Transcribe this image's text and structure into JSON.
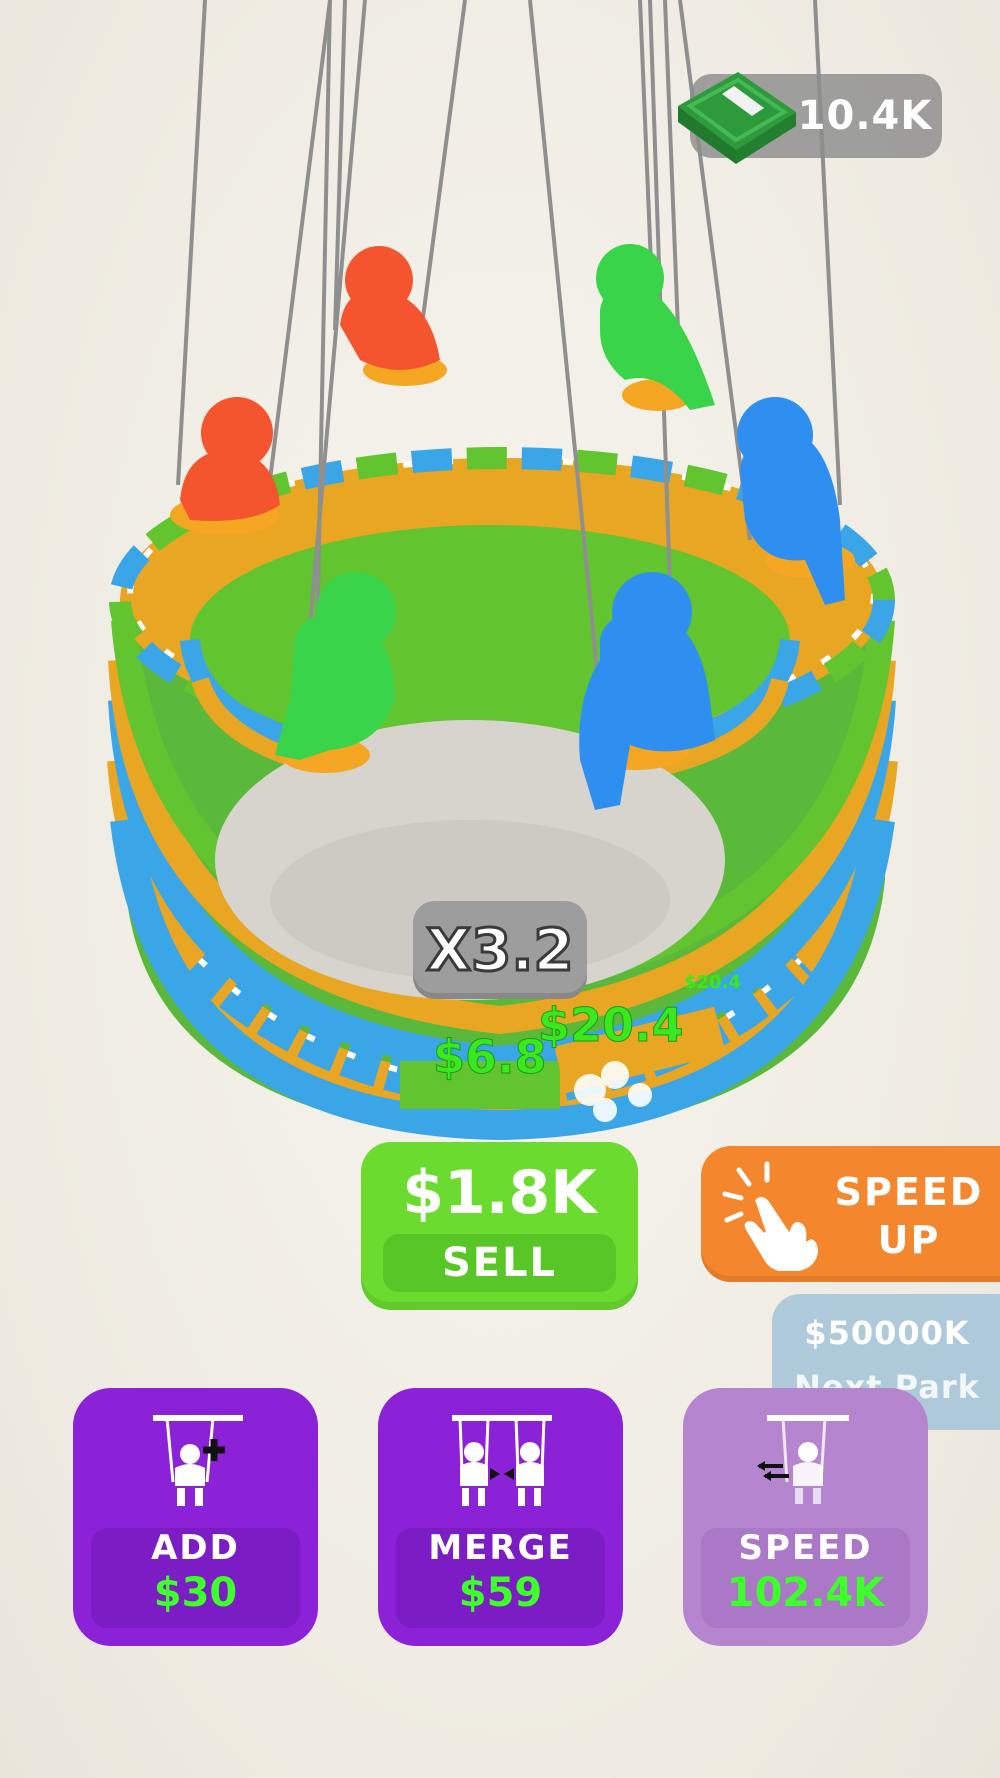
{
  "hud": {
    "money_value": "10.4K",
    "money_icon": "cash-bundle-icon"
  },
  "scene": {
    "multiplier": "X3.2",
    "floating_earnings": [
      "$6.8",
      "$20.4",
      "$20.4"
    ],
    "swing_riders": [
      {
        "color": "#f4552e"
      },
      {
        "color": "#f4552e"
      },
      {
        "color": "#3ad44a"
      },
      {
        "color": "#2f8ff0"
      },
      {
        "color": "#3ad44a"
      },
      {
        "color": "#2f8ff0"
      }
    ],
    "cash_colors": [
      "#3aa6e8",
      "#62c42f",
      "#e8a623"
    ]
  },
  "sell": {
    "amount": "$1.8K",
    "label": "SELL"
  },
  "speed_up": {
    "label_line1": "SPEED",
    "label_line2": "UP",
    "icon": "tap-hand-icon"
  },
  "next_park": {
    "amount": "$50000K",
    "label": "Next Park"
  },
  "upgrades": [
    {
      "label": "ADD",
      "price": "$30",
      "icon": "add-swing-icon"
    },
    {
      "label": "MERGE",
      "price": "$59",
      "icon": "merge-swings-icon"
    },
    {
      "label": "SPEED",
      "price": "102.4K",
      "icon": "speed-swing-icon"
    }
  ],
  "colors": {
    "sell_green": "#6bdc2f",
    "speed_orange": "#f4872e",
    "upgrade_purple": "#8c22d8",
    "price_green": "#3dff2a"
  }
}
